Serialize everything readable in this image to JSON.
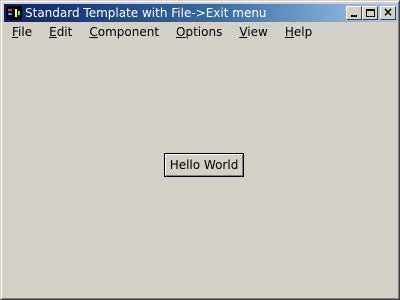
{
  "window": {
    "title": "Standard Template with File->Exit menu",
    "icon": "java-cup-app-icon",
    "controls": {
      "minimize_icon": "minimize-icon",
      "maximize_icon": "maximize-icon",
      "close_icon": "close-icon",
      "close_glyph": "×"
    }
  },
  "menubar": {
    "items": [
      {
        "mnemonic": "F",
        "rest": "ile"
      },
      {
        "mnemonic": "E",
        "rest": "dit"
      },
      {
        "mnemonic": "C",
        "rest": "omponent"
      },
      {
        "mnemonic": "O",
        "rest": "ptions"
      },
      {
        "mnemonic": "V",
        "rest": "iew"
      },
      {
        "mnemonic": "H",
        "rest": "elp"
      }
    ]
  },
  "content": {
    "button_label": "Hello World"
  },
  "colors": {
    "window_background": "#d4d0c8",
    "titlebar_start": "#0a246a",
    "titlebar_end": "#a6caf0",
    "title_text": "#ffffff"
  }
}
